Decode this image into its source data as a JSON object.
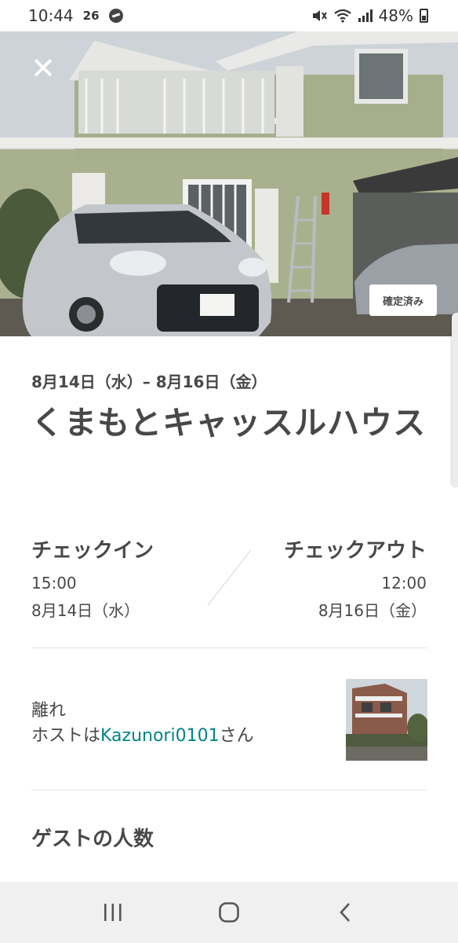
{
  "status_bar": {
    "time": "10:44",
    "indicator": "26",
    "battery_percent": "48%",
    "icons": [
      "messenger-icon",
      "mute-icon",
      "wifi-icon",
      "signal-icon",
      "battery-icon"
    ]
  },
  "hero": {
    "close_symbol": "✕",
    "badge": "確定済み"
  },
  "trip": {
    "dates": "8月14日（水）– 8月16日（金）",
    "title": "くまもとキャッスルハウス"
  },
  "checkin": {
    "label": "チェックイン",
    "time": "15:00",
    "date": "8月14日（水）"
  },
  "checkout": {
    "label": "チェックアウト",
    "time": "12:00",
    "date": "8月16日（金）"
  },
  "listing": {
    "room_type": "離れ",
    "host_prefix": "ホストは",
    "host_name": "Kazunori0101",
    "host_suffix": "さん"
  },
  "guests": {
    "heading": "ゲストの人数"
  },
  "nav": {
    "icons": [
      "recent-apps-icon",
      "home-icon",
      "back-icon"
    ]
  },
  "colors": {
    "text": "#484848",
    "link": "#008489",
    "nav_bg": "#f0f0f0"
  }
}
